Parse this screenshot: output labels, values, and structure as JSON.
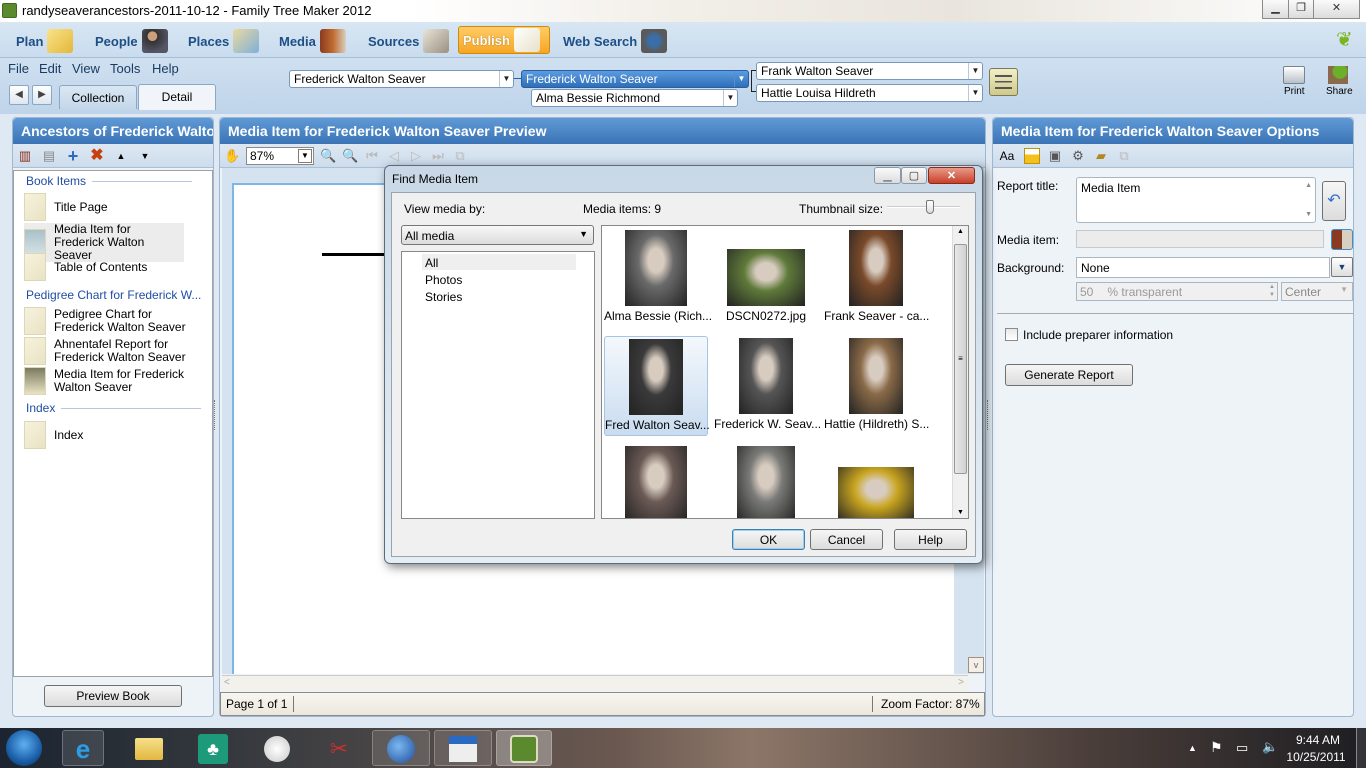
{
  "window": {
    "title": "randyseaverancestors-2011-10-12 - Family Tree Maker 2012",
    "controls": {
      "minimize": "▁",
      "restore": "❐",
      "close": "✕"
    }
  },
  "nav": {
    "items": [
      {
        "label": "Plan",
        "icon": "plan-notepad-icon",
        "active": false
      },
      {
        "label": "People",
        "icon": "people-couple-icon",
        "active": false
      },
      {
        "label": "Places",
        "icon": "places-map-icon",
        "active": false
      },
      {
        "label": "Media",
        "icon": "media-books-icon",
        "active": false
      },
      {
        "label": "Sources",
        "icon": "sources-quill-icon",
        "active": false
      },
      {
        "label": "Publish",
        "icon": "publish-book-icon",
        "active": true
      },
      {
        "label": "Web Search",
        "icon": "web-search-binoculars-icon",
        "active": false
      }
    ]
  },
  "menu": [
    "File",
    "Edit",
    "View",
    "Tools",
    "Help"
  ],
  "tabs": {
    "collection": "Collection",
    "detail": "Detail",
    "selected": "Detail"
  },
  "family": {
    "person": "Frederick Walton Seaver",
    "focus": "Frederick Walton Seaver",
    "spouse": "Alma Bessie Richmond",
    "father": "Frank Walton Seaver",
    "mother": "Hattie Louisa Hildreth"
  },
  "toolbar_right": {
    "print": "Print",
    "share": "Share"
  },
  "left_panel": {
    "title": "Ancestors of Frederick Walto...",
    "sections": [
      {
        "label": "Book Items",
        "items": [
          "Title Page",
          "Media Item for Frederick Walton Seaver",
          "Table of Contents"
        ]
      },
      {
        "label": "Pedigree Chart for Frederick W...",
        "items": [
          "Pedigree Chart for Frederick Walton Seaver",
          "Ahnentafel Report for Frederick Walton Seaver",
          "Media Item for Frederick Walton Seaver"
        ]
      },
      {
        "label": "Index",
        "items": [
          "Index"
        ]
      }
    ],
    "preview_button": "Preview Book"
  },
  "preview": {
    "title": "Media Item for Frederick Walton Seaver Preview",
    "zoom": "87%",
    "status_page": "Page 1 of 1",
    "status_zoom": "Zoom Factor: 87%"
  },
  "dialog": {
    "title": "Find Media Item",
    "view_by_label": "View media by:",
    "media_count": "Media items: 9",
    "thumb_size_label": "Thumbnail size:",
    "thumb_size_value": 0.6,
    "view_select": "All media",
    "categories": [
      "All",
      "Photos",
      "Stories"
    ],
    "selected_category": "All",
    "items": [
      {
        "caption": "Alma Bessie (Rich...",
        "tone": "#6a6a6a"
      },
      {
        "caption": "DSCN0272.jpg",
        "tone": "#5f7a3a"
      },
      {
        "caption": "Frank Seaver - ca...",
        "tone": "#7a4a2a"
      },
      {
        "caption": "Fred Walton Seav...",
        "tone": "#3a3a3a",
        "selected": true
      },
      {
        "caption": "Frederick W. Seav...",
        "tone": "#555555"
      },
      {
        "caption": "Hattie (Hildreth) S...",
        "tone": "#8a6a48"
      },
      {
        "caption": "",
        "tone": "#6b5a55"
      },
      {
        "caption": "",
        "tone": "#7a7a78"
      },
      {
        "caption": "",
        "tone": "#c9a520"
      }
    ],
    "buttons": {
      "ok": "OK",
      "cancel": "Cancel",
      "help": "Help"
    }
  },
  "options": {
    "title": "Media Item for Frederick Walton Seaver Options",
    "report_title_label": "Report title:",
    "report_title_value": "Media Item",
    "media_item_label": "Media item:",
    "media_item_value": "",
    "background_label": "Background:",
    "background_value": "None",
    "transparency_value": "50",
    "transparency_unit": "% transparent",
    "alignment": "Center",
    "include_preparer": "Include preparer information",
    "include_preparer_checked": false,
    "generate_button": "Generate Report"
  },
  "taskbar": {
    "apps": [
      "start-orb",
      "internet-explorer",
      "windows-explorer",
      "ancestry-tree",
      "openoffice-impress",
      "snipping-tool",
      "thunderbird",
      "odf-viewer",
      "family-tree-maker"
    ],
    "time": "9:44 AM",
    "date": "10/25/2011"
  }
}
